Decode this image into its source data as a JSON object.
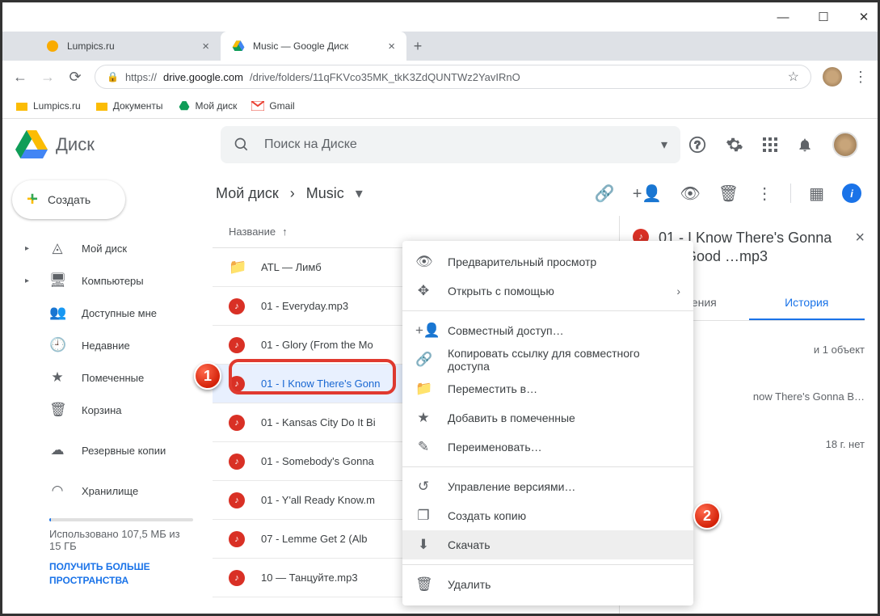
{
  "window": {
    "min": "—",
    "max": "☐",
    "close": "✕"
  },
  "tabs": [
    {
      "title": "Lumpics.ru",
      "active": false
    },
    {
      "title": "Music — Google Диск",
      "active": true
    }
  ],
  "url": {
    "proto": "https://",
    "host": "drive.google.com",
    "path": "/drive/folders/11qFKVco35MK_tkK3ZdQUNTWz2YavIRnO"
  },
  "bookmarks": [
    {
      "label": "Lumpics.ru",
      "color": "#fbbc04"
    },
    {
      "label": "Документы",
      "color": "#fbbc04"
    },
    {
      "label": "Мой диск",
      "color": "drive"
    },
    {
      "label": "Gmail",
      "color": "gmail"
    }
  ],
  "drive": {
    "logo_text": "Диск",
    "search_placeholder": "Поиск на Диске"
  },
  "sidebar": {
    "create": "Создать",
    "items": [
      {
        "label": "Мой диск",
        "icon": "drive-icon",
        "expand": true
      },
      {
        "label": "Компьютеры",
        "icon": "devices-icon",
        "expand": true
      },
      {
        "label": "Доступные мне",
        "icon": "shared-icon"
      },
      {
        "label": "Недавние",
        "icon": "recent-icon"
      },
      {
        "label": "Помеченные",
        "icon": "star-icon"
      },
      {
        "label": "Корзина",
        "icon": "trash-icon"
      },
      {
        "label": "Резервные копии",
        "icon": "backup-icon"
      },
      {
        "label": "Хранилище",
        "icon": "cloud-icon"
      }
    ],
    "storage_used": "Использовано 107,5 МБ из 15 ГБ",
    "storage_link": "ПОЛУЧИТЬ БОЛЬШЕ ПРОСТРАНСТВА"
  },
  "breadcrumb": {
    "root": "Мой диск",
    "sep": "›",
    "current": "Music"
  },
  "list_header": {
    "name": "Название",
    "arrow": "↑"
  },
  "files": [
    {
      "name": "ATL — Лимб",
      "type": "folder"
    },
    {
      "name": "01 - Everyday.mp3",
      "type": "audio"
    },
    {
      "name": "01 - Glory (From the Mo",
      "type": "audio"
    },
    {
      "name": "01 - I Know There's Gonn",
      "type": "audio",
      "selected": true
    },
    {
      "name": "01 - Kansas City Do It Bi",
      "type": "audio"
    },
    {
      "name": "01 - Somebody's Gonna",
      "type": "audio"
    },
    {
      "name": "01 - Y'all Ready Know.m",
      "type": "audio"
    },
    {
      "name": "07 - Lemme Get 2 (Alb",
      "type": "audio"
    },
    {
      "name": "10 — Танцуйте.mp3",
      "type": "audio"
    }
  ],
  "context_menu": {
    "items": [
      {
        "label": "Предварительный просмотр",
        "icon": "eye-icon"
      },
      {
        "label": "Открыть с помощью",
        "icon": "open-with-icon",
        "submenu": true
      },
      {
        "sep": true
      },
      {
        "label": "Совместный доступ…",
        "icon": "person-add-icon"
      },
      {
        "label": "Копировать ссылку для совместного доступа",
        "icon": "link-icon"
      },
      {
        "label": "Переместить в…",
        "icon": "move-icon"
      },
      {
        "label": "Добавить в помеченные",
        "icon": "star-icon"
      },
      {
        "label": "Переименовать…",
        "icon": "rename-icon"
      },
      {
        "sep": true
      },
      {
        "label": "Управление версиями…",
        "icon": "history-icon"
      },
      {
        "label": "Создать копию",
        "icon": "copy-icon"
      },
      {
        "label": "Скачать",
        "icon": "download-icon",
        "highlighted": true
      },
      {
        "sep": true
      },
      {
        "label": "Удалить",
        "icon": "delete-icon"
      }
    ]
  },
  "details": {
    "title": "01 - I Know There's Gonna Be (Good …mp3",
    "tabs": {
      "info": "Сведения",
      "activity": "История"
    },
    "rows": [
      {
        "text": "и 1 объект"
      },
      {
        "text": "now There's Gonna B…"
      },
      {
        "text": "18 г. нет"
      }
    ]
  },
  "badges": {
    "one": "1",
    "two": "2"
  }
}
